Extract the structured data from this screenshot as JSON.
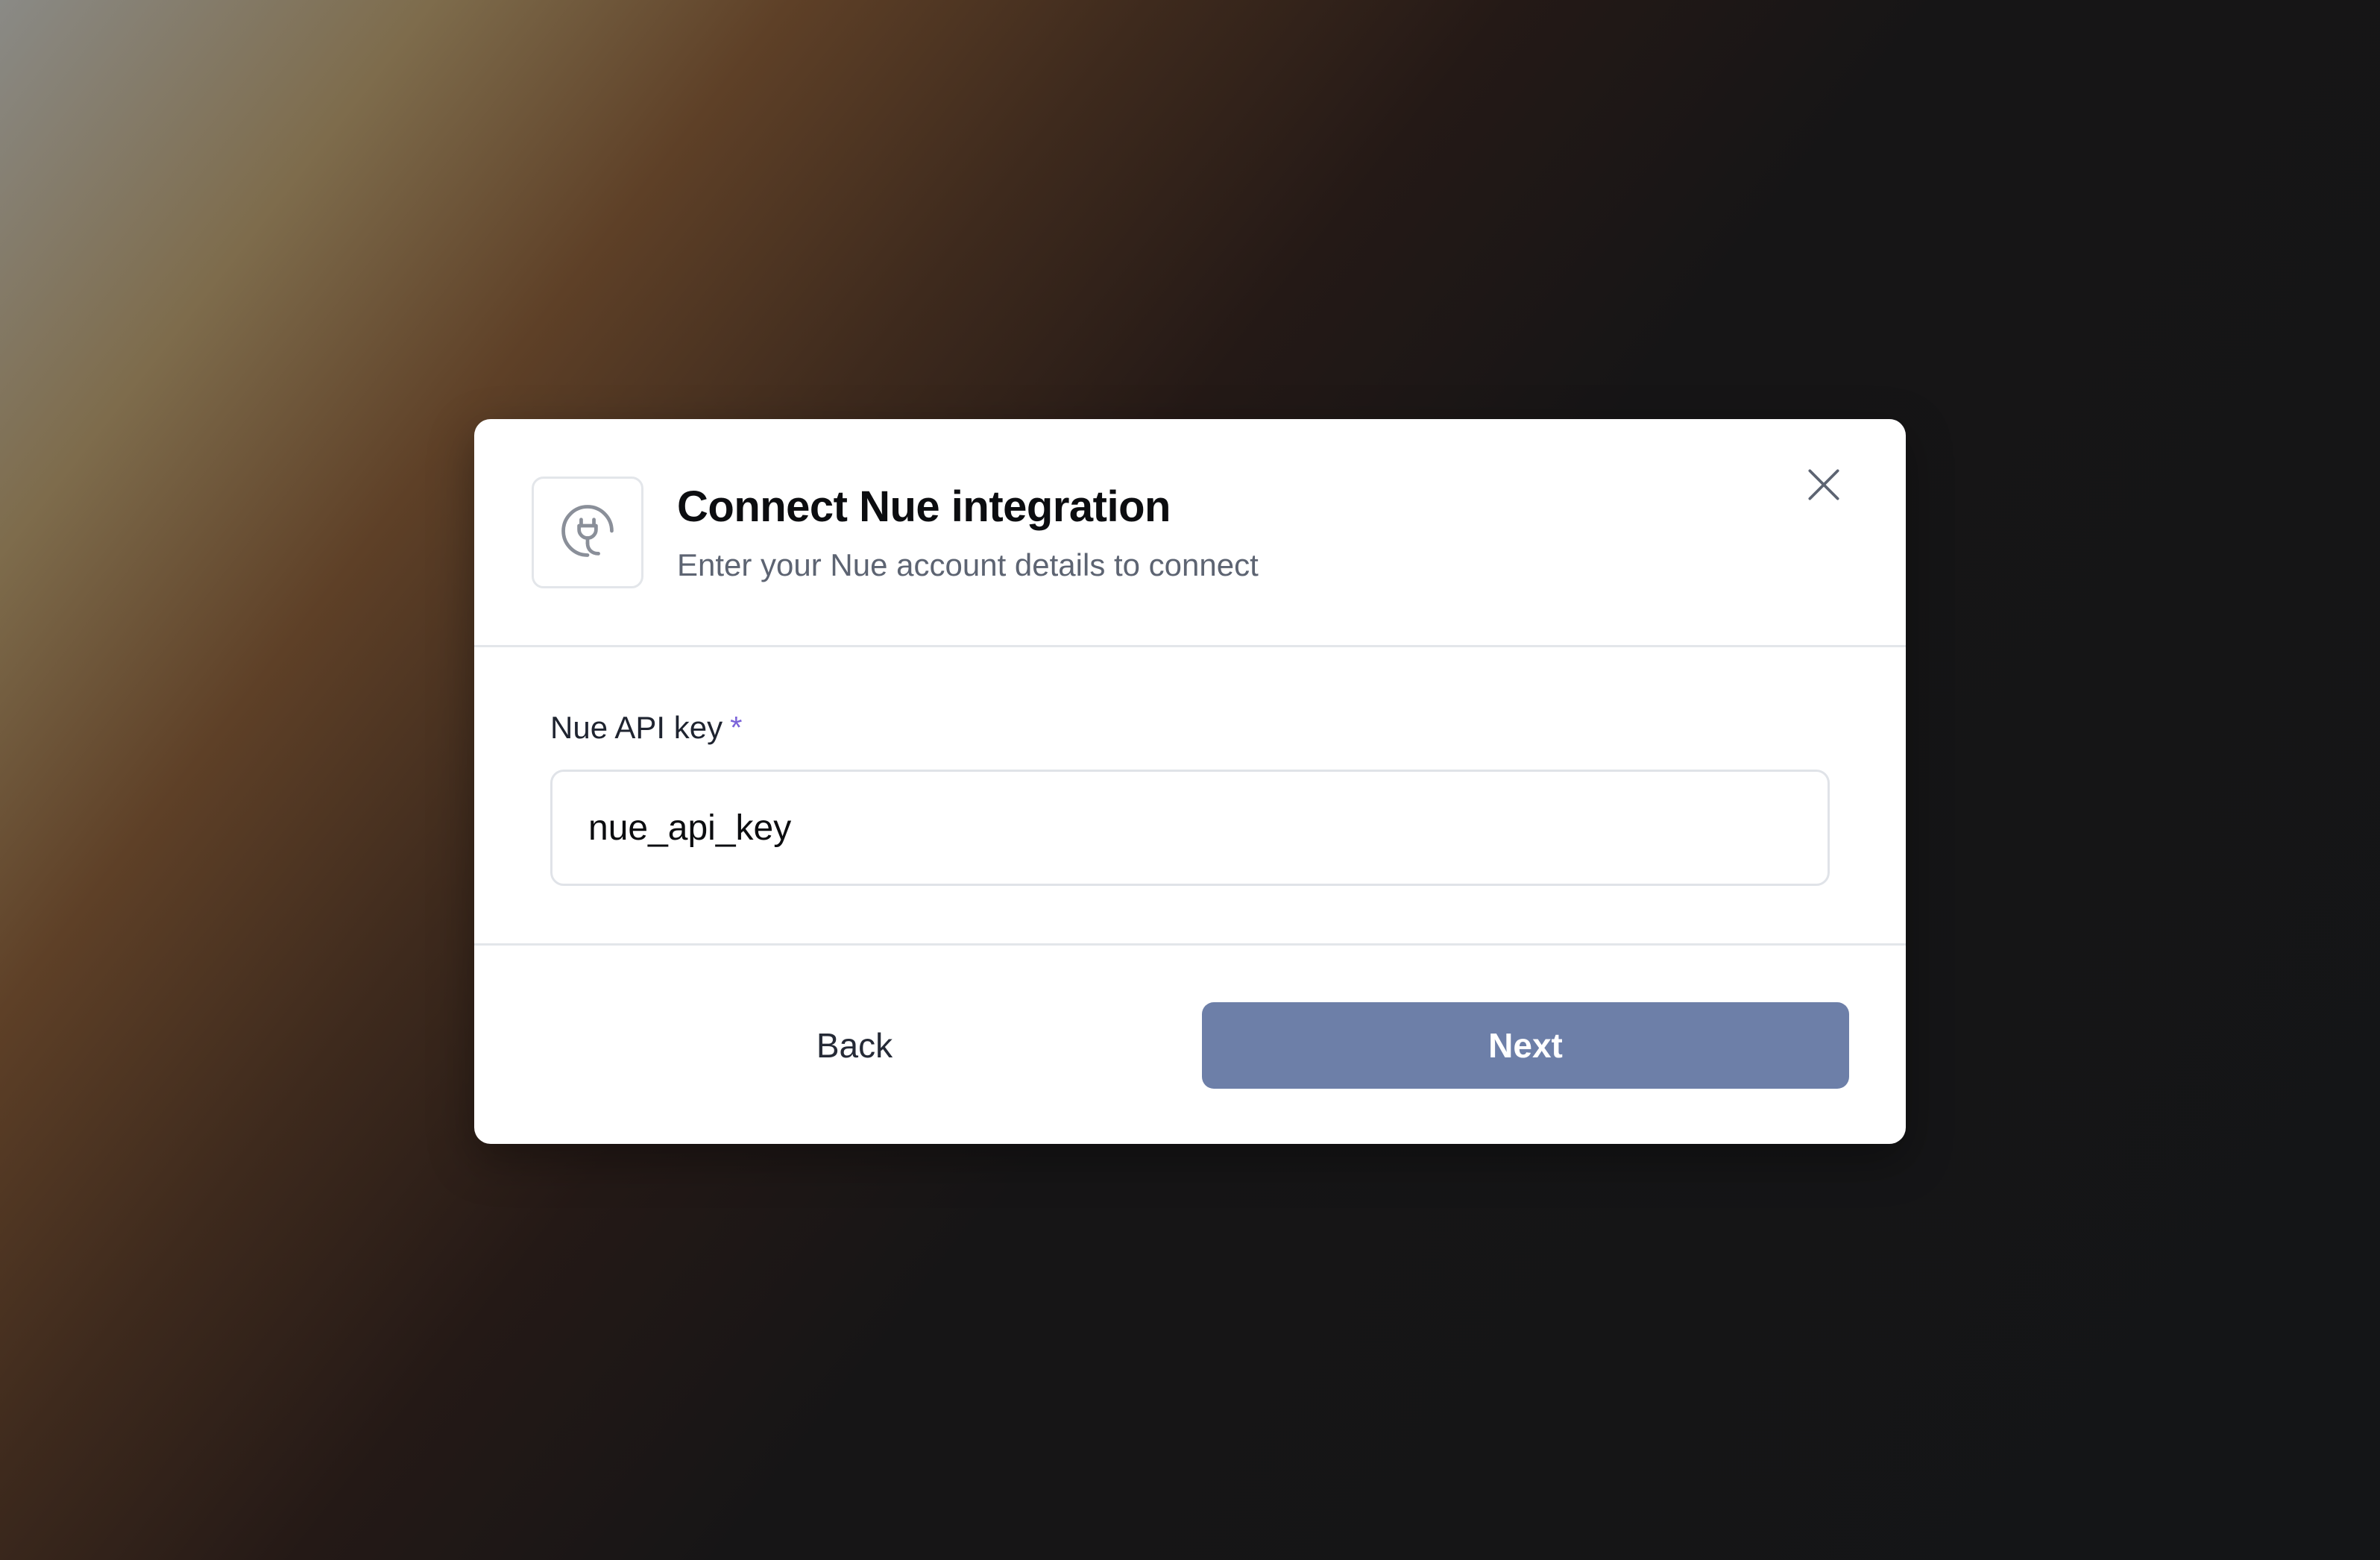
{
  "dialog": {
    "title": "Connect Nue integration",
    "subtitle": "Enter your Nue account details to connect",
    "header_icon": "plug-icon",
    "close_icon": "close-icon"
  },
  "form": {
    "api_key_label": "Nue API key",
    "required_marker": "*",
    "api_key_value": "nue_api_key"
  },
  "footer": {
    "back_label": "Back",
    "next_label": "Next"
  },
  "colors": {
    "primary_button": "#6d7fa8",
    "required_accent": "#7b63d9",
    "title_text": "#0c0d10",
    "subtitle_text": "#5d6472"
  }
}
